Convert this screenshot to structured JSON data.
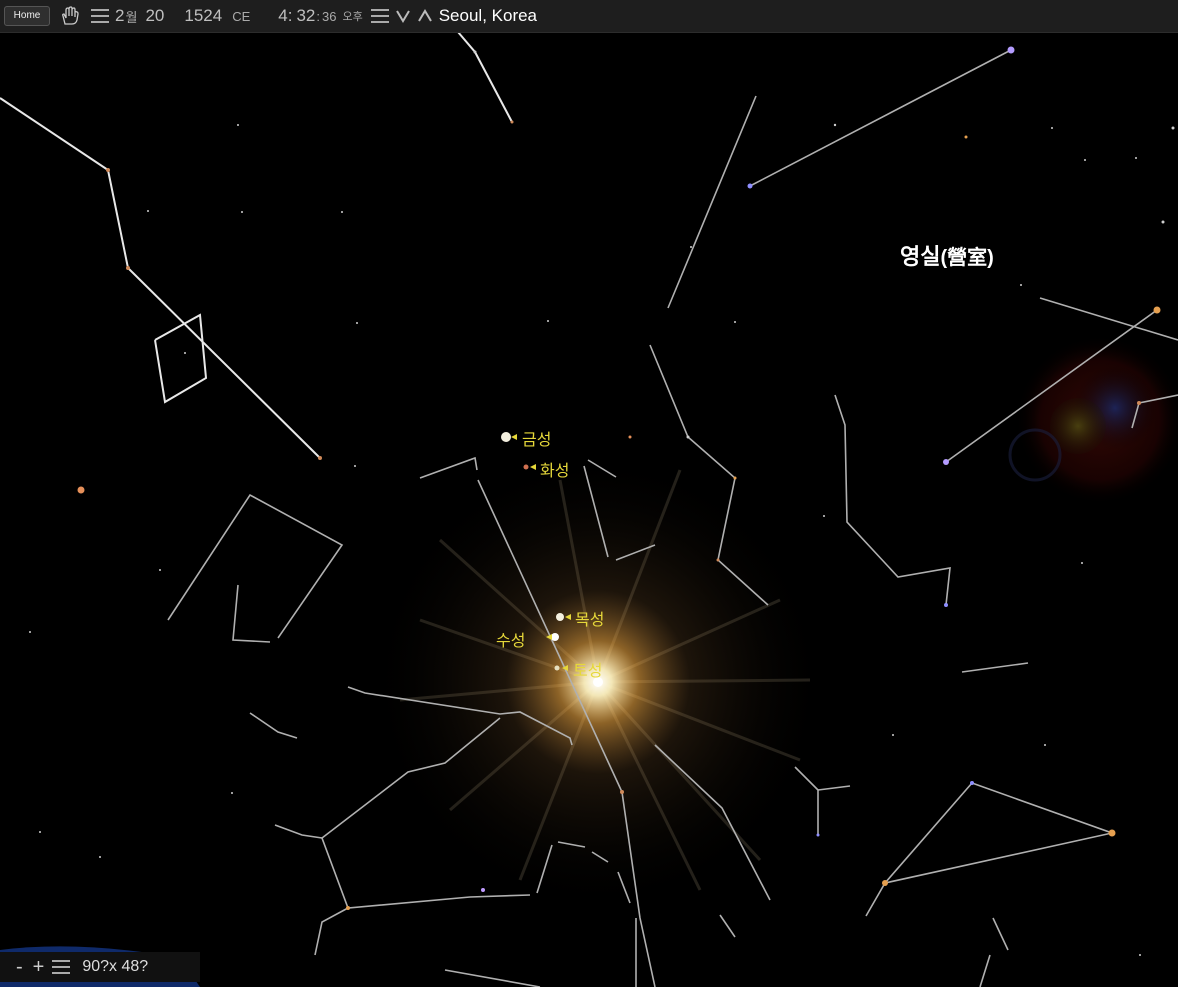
{
  "topbar": {
    "home_label": "Home",
    "month": "2",
    "month_unit": "월",
    "day": "20",
    "year": "1524",
    "era": "CE",
    "hour": "4",
    "minute": "32",
    "second": "36",
    "ampm": "오후",
    "location": "Seoul, Korea",
    "icons": [
      "hand-icon",
      "menu-icon",
      "chevron-down-icon",
      "chevron-up-icon"
    ]
  },
  "constellation_label": {
    "name": "영실",
    "hanja": "(營室)"
  },
  "planets": {
    "venus": "금성",
    "mars": "화성",
    "jupiter": "목성",
    "mercury": "수성",
    "saturn": "토성"
  },
  "bottombar": {
    "zoom_out": "-",
    "zoom_in": "+",
    "fov": "90?x 48?"
  },
  "colors": {
    "planet_label": "#e6d83a",
    "line": "#bdbdbd",
    "sun_glow": "#ffb347"
  }
}
